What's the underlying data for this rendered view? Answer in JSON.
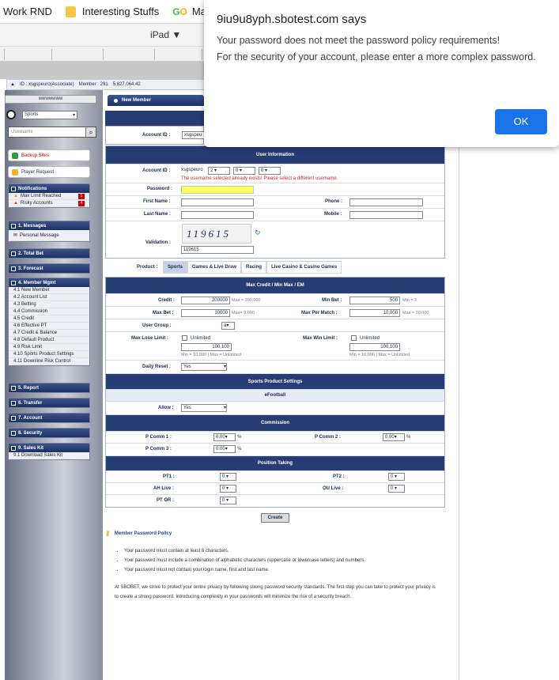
{
  "bookmarks": [
    {
      "label": "Work RND"
    },
    {
      "label": "Interesting Stuffs"
    },
    {
      "label": "Main"
    }
  ],
  "device": {
    "label": "iPad ▼"
  },
  "dialog": {
    "title": "9iu9u8yph.sbotest.com says",
    "line1": "Your password does not meet the password policy requirements!",
    "line2": "For the security of your account, please enter a more complex password.",
    "ok": "OK"
  },
  "info": {
    "id": "ID : xsgspeuro(Associate)",
    "member": "Member : 291",
    "amount": "5,827,064.42"
  },
  "sidebar": {
    "top": "wwwwwww",
    "sport": "Sports",
    "search_placeholder": "Username",
    "backup": "Backup Sites",
    "player_request": "Player Request",
    "groups": [
      {
        "title": "Notifications",
        "items": [
          {
            "label": "Max Limit Reached",
            "count": "1"
          },
          {
            "label": "Risky Accounts",
            "count": "4"
          }
        ]
      },
      {
        "title": "1. Messages",
        "items": [
          {
            "label": "Personal Message"
          }
        ]
      },
      {
        "title": "2. Total Bet",
        "items": []
      },
      {
        "title": "3. Forecast",
        "items": []
      },
      {
        "title": "4. Member Mgmt",
        "items": [
          {
            "label": "4.1 New Member"
          },
          {
            "label": "4.2 Account List"
          },
          {
            "label": "4.3 Betting"
          },
          {
            "label": "4.4 Commission"
          },
          {
            "label": "4.5 Credit"
          },
          {
            "label": "4.6 Effective PT"
          },
          {
            "label": "4.7 Credit & Balance"
          },
          {
            "label": "4.8 Default Product"
          },
          {
            "label": "4.9 Risk Limit"
          },
          {
            "label": "4.10 Sports Product Settings"
          },
          {
            "label": "4.11 Downline Risk Control"
          }
        ]
      },
      {
        "title": "5. Report",
        "items": []
      },
      {
        "title": "6. Transfer",
        "items": []
      },
      {
        "title": "7. Account",
        "items": []
      },
      {
        "title": "8. Security",
        "items": []
      },
      {
        "title": "9. Sales Kit",
        "items": [
          {
            "label": "9.1 Download Sales Kit"
          }
        ]
      }
    ]
  },
  "main": {
    "tab": "New Member",
    "account_id_label": "Account ID :",
    "account_id_value": "xsgspeu",
    "user_info": "User Information",
    "acc_prefix": "xsgspeuro",
    "acc_sel": [
      "2",
      "0",
      "0"
    ],
    "error": "The username selected already exists! Please select a different username.",
    "password": "Password :",
    "first_name": "First Name :",
    "last_name": "Last Name :",
    "phone": "Phone :",
    "mobile": "Mobile :",
    "validation": "Validation :",
    "captcha": "119615",
    "captcha_input": "119615",
    "product": "Product :",
    "tabs": [
      "Sports",
      "Games & Live Draw",
      "Racing",
      "Live Casino & Casino Games"
    ],
    "max_header": "Max Credit / Min Max / EM",
    "credit": "Credit :",
    "credit_val": "200000",
    "credit_hint": "Max = 190,000",
    "min_bet": "Min Bet :",
    "min_bet_val": "500",
    "min_bet_hint": "Min = 2",
    "max_bet": "Max Bet :",
    "max_bet_val": "10000",
    "max_bet_hint": "Max= 9,000",
    "max_match": "Max Per Match :",
    "max_match_val": "10,000",
    "max_match_hint": "Max = 10,000",
    "user_group": "User Group :",
    "user_group_val": "a",
    "max_lose": "Max Lose Limit :",
    "unlimited": "Unlimited",
    "lose_val": "100,100",
    "lose_hint": "Min = 10,000 | Max = Unlimited",
    "max_win": "Max Win Limit :",
    "win_val": "100,100",
    "win_hint": "Min = 10,000 | Max = Unlimited",
    "daily_reset": "Daily Reset :",
    "daily_reset_val": "Yes",
    "sports_settings": "Sports Product Settings",
    "efootball": "eFootball",
    "allow": "Allow :",
    "allow_val": "Yes",
    "commission": "Commission",
    "pcomm1": "P Comm 1 :",
    "pcomm2": "P Comm 2 :",
    "pcomm3": "P Comm 3 :",
    "comm_val": "0.00",
    "pct": "%",
    "position": "Position Taking",
    "pt1": "PT1 :",
    "pt2": "PT2 :",
    "ahlive": "AH Live :",
    "oulive": "OU Live :",
    "ptor": "PT OR :",
    "zero": "0",
    "create": "Create"
  },
  "policy": {
    "title": "Member Password Policy",
    "rules": [
      "Your password must contain at least 8 characters.",
      "Your password must include a combination of alphabetic characters (uppercase or lowercase letters) and numbers.",
      "Your password must not contain your login name, first and last name."
    ],
    "text": "At SBOBET, we strive to protect your online privacy by following strong password security standards. The first step you can take to protect your privacy is to create a strong password. Introducing complexity in your passwords will minimize the risk of a security breach."
  },
  "colors": {
    "navy": "#263d74",
    "ok_blue": "#1a73e8",
    "error_red": "#d2232a",
    "highlight_yellow": "#ffff66"
  }
}
